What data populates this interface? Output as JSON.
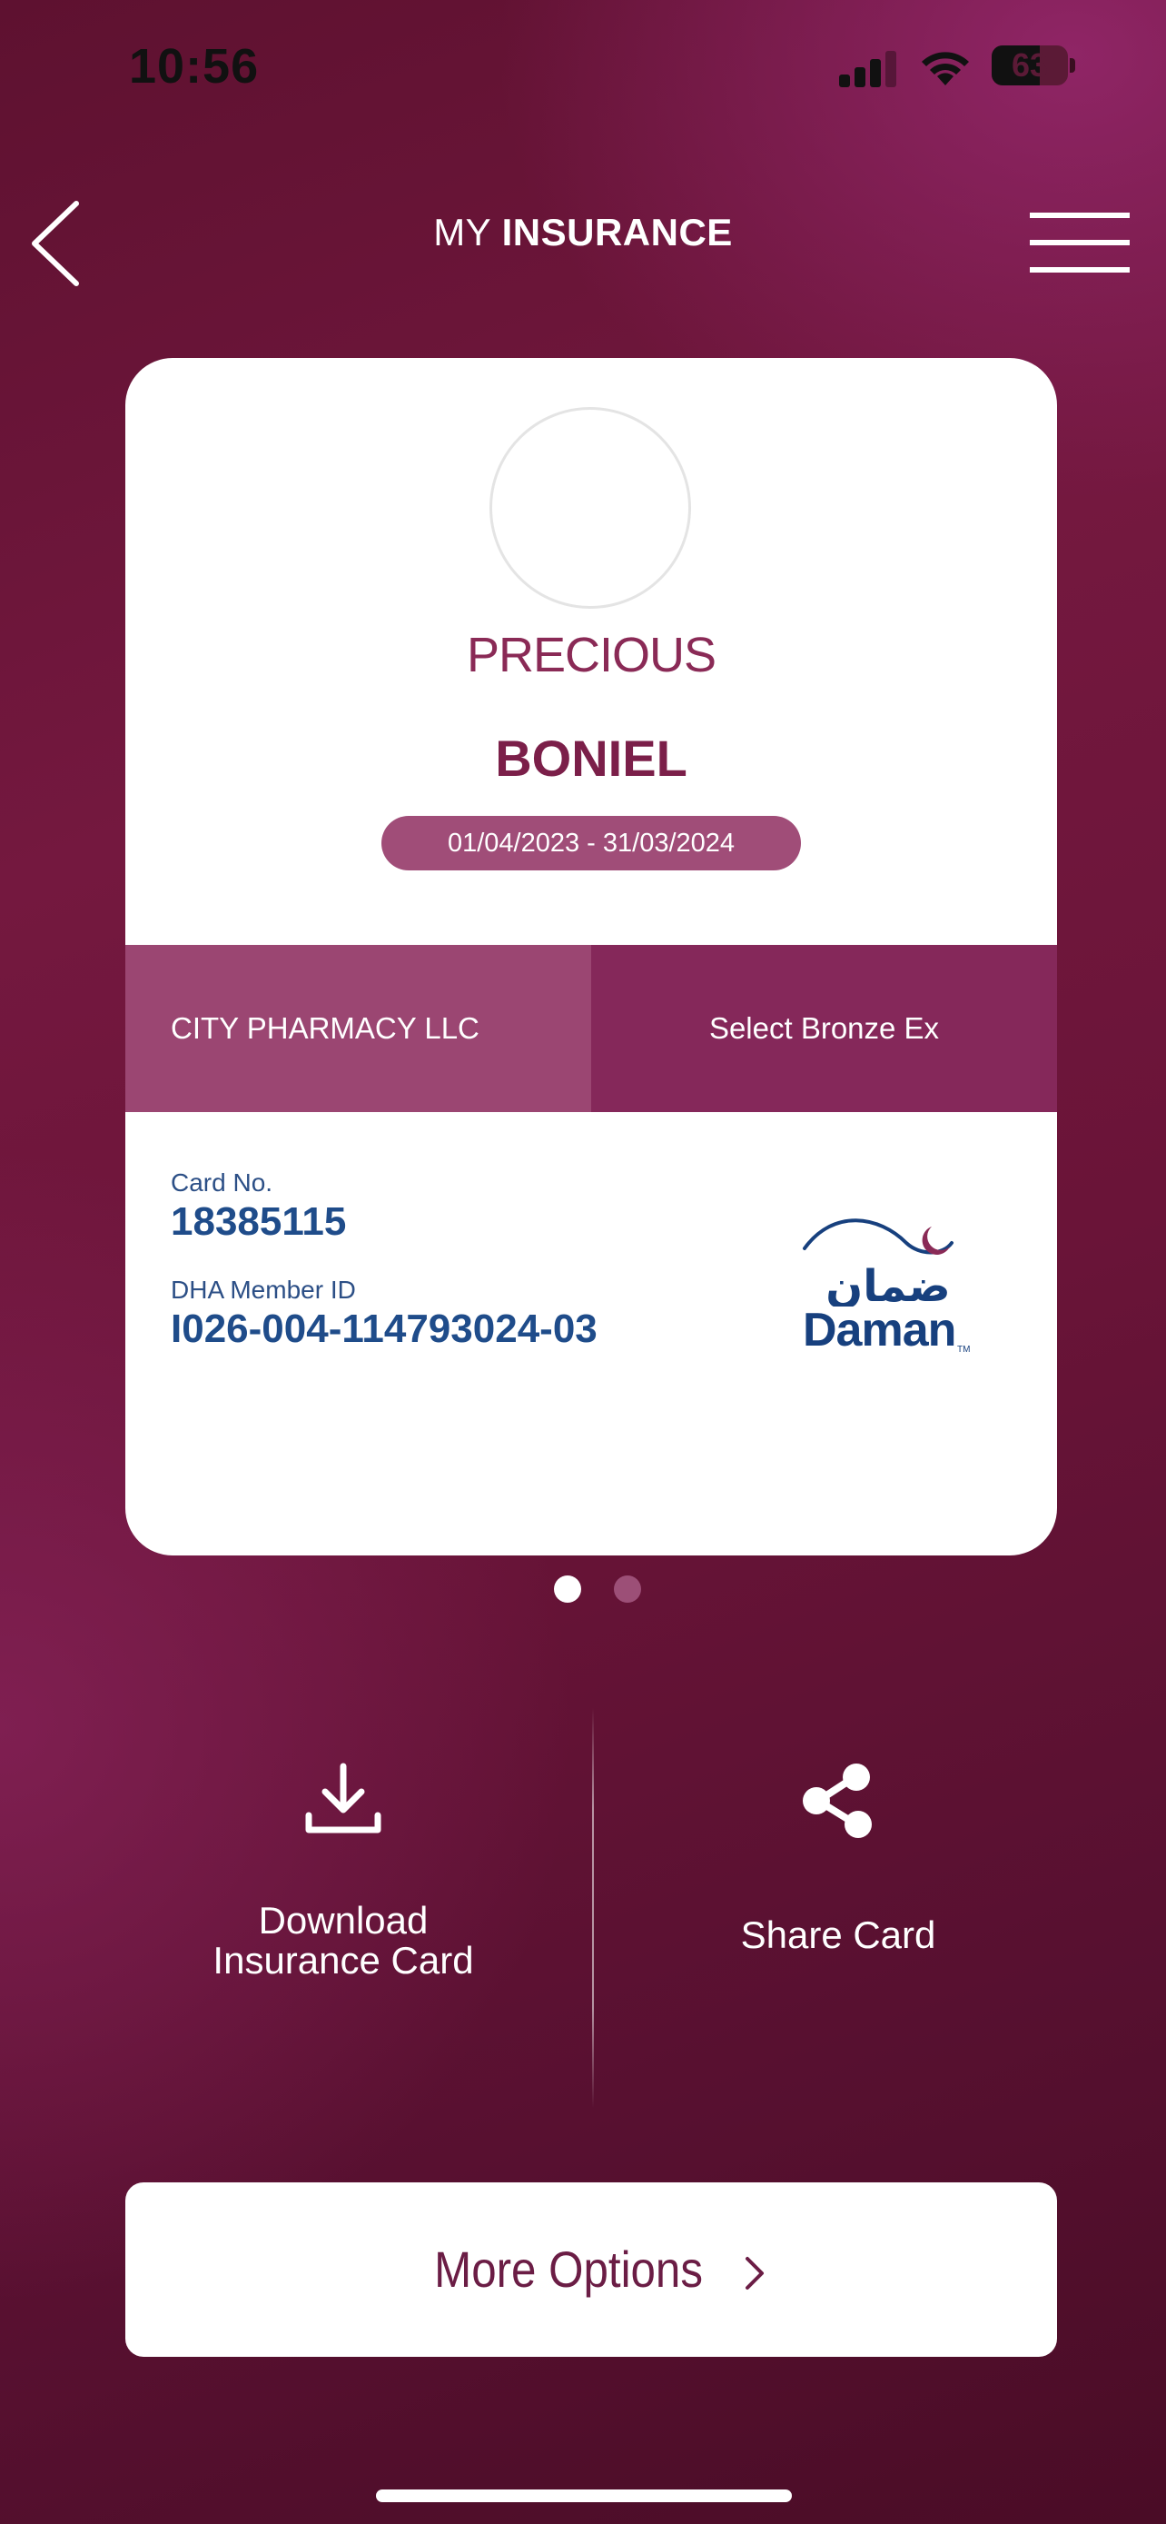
{
  "status_bar": {
    "time": "10:56",
    "battery_percent": "63",
    "battery_level": 0.63
  },
  "header": {
    "title_light": "MY ",
    "title_bold": "INSURANCE"
  },
  "card": {
    "first_name": "PRECIOUS",
    "last_name": "BONIEL",
    "validity": "01/04/2023 - 31/03/2024",
    "employer": "CITY PHARMACY LLC",
    "plan": "Select Bronze Ex",
    "card_no_label": "Card No.",
    "card_no": "18385115",
    "dha_label": "DHA Member ID",
    "dha_id": "I026-004-114793024-03",
    "logo_arabic": "ضمان",
    "logo_text": "Daman",
    "logo_tm": "TM"
  },
  "pager": {
    "current": 1,
    "total": 2
  },
  "actions": {
    "download_label": "Download\nInsurance Card",
    "share_label": "Share Card"
  },
  "more_options": {
    "label": "More Options"
  },
  "colors": {
    "brand_maroon": "#7b1f49",
    "band_light": "#9b4672",
    "band_dark": "#85285a",
    "link_blue": "#1f4c8a"
  }
}
